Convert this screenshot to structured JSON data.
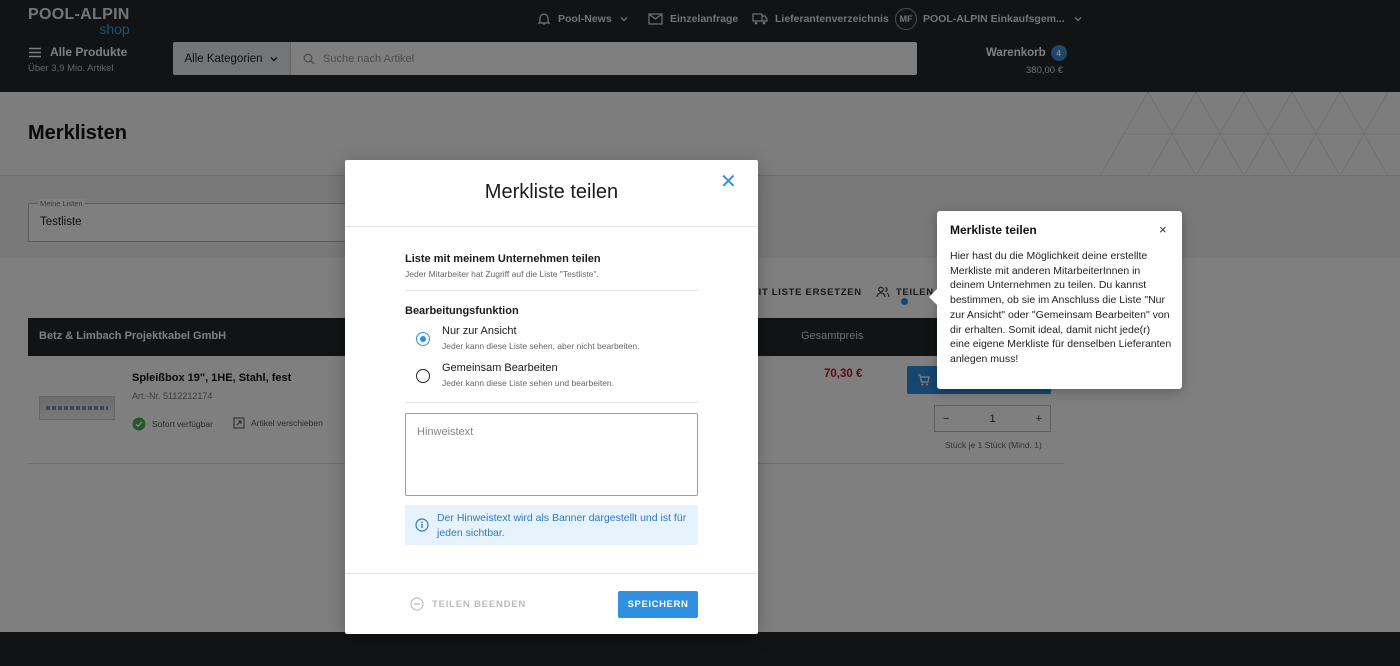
{
  "header": {
    "logo": {
      "line1": "POOL-ALPIN",
      "line2": "shop"
    },
    "nav": [
      {
        "label": "Pool-News",
        "icon": "bell-icon"
      },
      {
        "label": "Einzelanfrage",
        "icon": "mail-icon"
      },
      {
        "label": "Lieferantenverzeichnis",
        "icon": "truck-icon"
      }
    ],
    "account": {
      "initials": "MF",
      "label": "POOL-ALPIN Einkaufsgem..."
    },
    "all_products": {
      "title": "Alle Produkte",
      "subtitle": "Über 3,9 Mio. Artikel"
    },
    "category_button": "Alle Kategorien",
    "search": {
      "placeholder": "Suche nach Artikel"
    },
    "cart": {
      "label": "Warenkorb",
      "count": "4",
      "total": "380,00 €"
    }
  },
  "page": {
    "title": "Merklisten",
    "list_select": {
      "label": "Meine Listen",
      "value": "Testliste"
    },
    "actions": {
      "replace": "MIT LISTE ERSETZEN",
      "share": "TEILEN"
    },
    "table": {
      "supplier": "Betz & Limbach Projektkabel GmbH",
      "total_header": "Gesamtpreis",
      "rows": [
        {
          "name": "Spleißbox 19\", 1HE, Stahl, fest",
          "article_no": "Art.-Nr. 5112212174",
          "status": "Sofort verfügbar",
          "move": "Artikel verschieben",
          "price": "70,30 €",
          "quantity": "1",
          "unit": "Stück je 1 Stück (Mind. 1)"
        }
      ]
    }
  },
  "modal": {
    "title": "Merkliste teilen",
    "share_company": {
      "heading": "Liste mit meinem Unternehmen teilen",
      "description": "Jeder Mitarbeiter hat Zugriff auf die Liste \"Testliste\"."
    },
    "edit_function": {
      "heading": "Bearbeitungsfunktion",
      "options": [
        {
          "label": "Nur zur Ansicht",
          "description": "Jeder kann diese Liste sehen, aber nicht bearbeiten.",
          "selected": true
        },
        {
          "label": "Gemeinsam Bearbeiten",
          "description": "Jeder kann diese Liste sehen und bearbeiten.",
          "selected": false
        }
      ]
    },
    "hint": {
      "placeholder": "Hinweistext",
      "value": ""
    },
    "info": "Der Hinweistext wird als Banner dargestellt und ist für jeden sichtbar.",
    "end_share": "TEILEN BEENDEN",
    "save": "SPEICHERN"
  },
  "tooltip": {
    "title": "Merkliste teilen",
    "close": "×",
    "body": "Hier hast du die Möglichkeit deine erstellte Merkliste mit anderen MitarbeiterInnen in deinem Unternehmen zu teilen. Du kannst bestimmen, ob sie im Anschluss die Liste \"Nur zur Ansicht\" oder \"Gemeinsam Bearbeiten\" von dir erhalten. Somit ideal, damit nicht jede(r) eine eigene Merkliste für denselben Lieferanten anlegen muss!"
  },
  "colors": {
    "accent": "#2f8fe0",
    "header_bg": "#23262b",
    "price": "#c0102d",
    "info_bg": "#e6f2fc"
  }
}
